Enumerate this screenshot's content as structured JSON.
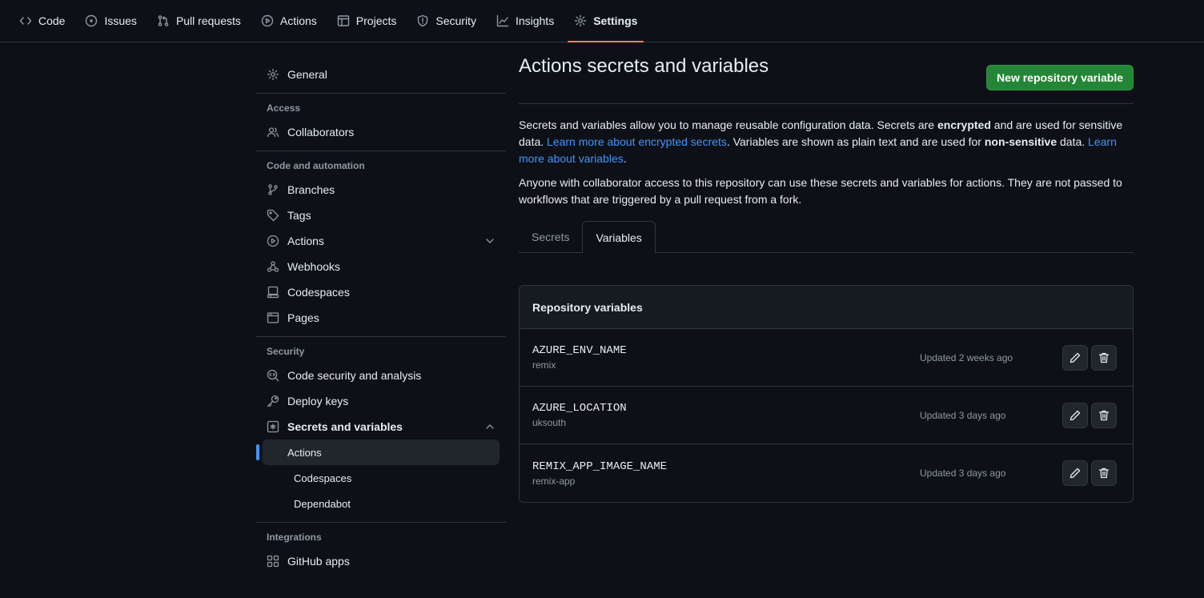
{
  "repo_nav": [
    {
      "label": "Code",
      "icon": "code-icon"
    },
    {
      "label": "Issues",
      "icon": "issue-icon"
    },
    {
      "label": "Pull requests",
      "icon": "pull-request-icon"
    },
    {
      "label": "Actions",
      "icon": "play-icon"
    },
    {
      "label": "Projects",
      "icon": "table-icon"
    },
    {
      "label": "Security",
      "icon": "shield-icon"
    },
    {
      "label": "Insights",
      "icon": "graph-icon"
    },
    {
      "label": "Settings",
      "icon": "gear-icon",
      "selected": true
    }
  ],
  "sidebar": {
    "general": "General",
    "access_heading": "Access",
    "collaborators": "Collaborators",
    "code_heading": "Code and automation",
    "branches": "Branches",
    "tags": "Tags",
    "actions": "Actions",
    "webhooks": "Webhooks",
    "codespaces": "Codespaces",
    "pages": "Pages",
    "security_heading": "Security",
    "code_security": "Code security and analysis",
    "deploy_keys": "Deploy keys",
    "secrets_vars": "Secrets and variables",
    "sub_actions": "Actions",
    "sub_codespaces": "Codespaces",
    "sub_dependabot": "Dependabot",
    "integrations_heading": "Integrations",
    "github_apps": "GitHub apps"
  },
  "main": {
    "title": "Actions secrets and variables",
    "new_button": "New repository variable",
    "desc1_a": "Secrets and variables allow you to manage reusable configuration data. Secrets are ",
    "desc1_b": "encrypted",
    "desc1_c": " and are used for sensitive data. ",
    "desc1_link1": "Learn more about encrypted secrets",
    "desc1_d": ". Variables are shown as plain text and are used for ",
    "desc1_e": "non-sensitive",
    "desc1_f": " data. ",
    "desc1_link2": "Learn more about variables",
    "desc1_g": ".",
    "desc2": "Anyone with collaborator access to this repository can use these secrets and variables for actions. They are not passed to workflows that are triggered by a pull request from a fork.",
    "tabs": [
      {
        "label": "Secrets",
        "selected": false
      },
      {
        "label": "Variables",
        "selected": true
      }
    ],
    "table_heading": "Repository variables",
    "variables": [
      {
        "name": "AZURE_ENV_NAME",
        "value": "remix",
        "updated": "Updated 2 weeks ago"
      },
      {
        "name": "AZURE_LOCATION",
        "value": "uksouth",
        "updated": "Updated 3 days ago"
      },
      {
        "name": "REMIX_APP_IMAGE_NAME",
        "value": "remix-app",
        "updated": "Updated 3 days ago"
      }
    ]
  },
  "colors": {
    "background": "#0d1117",
    "accent_tab": "#f78166",
    "primary_button": "#238636",
    "link": "#4493f8",
    "border": "#30363d"
  }
}
